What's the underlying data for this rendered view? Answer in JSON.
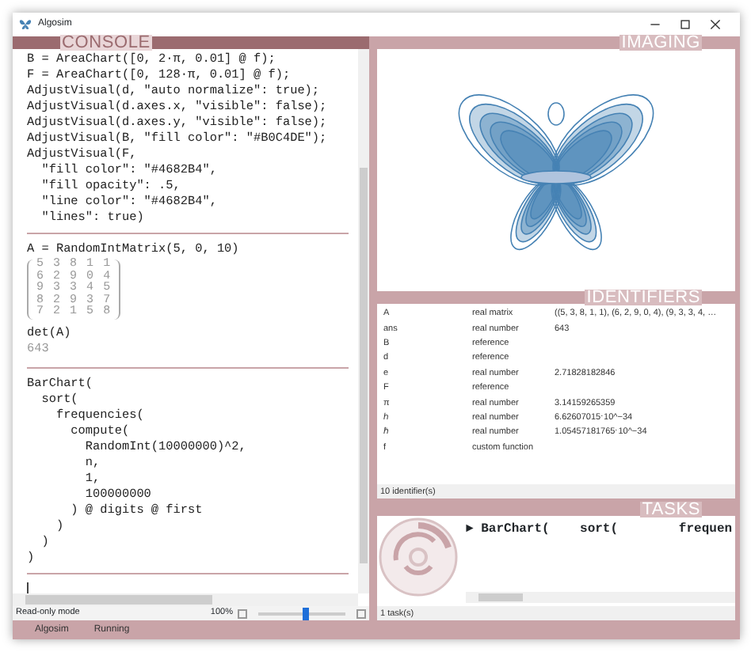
{
  "window": {
    "title": "Algosim"
  },
  "console": {
    "header": "CONSOLE",
    "blocks": [
      {
        "items": [
          {
            "input": [
              "B = AreaChart([0, 2·π, 0.01] @ f);",
              "F = AreaChart([0, 128·π, 0.01] @ f);",
              "AdjustVisual(d, \"auto normalize\": true);",
              "AdjustVisual(d.axes.x, \"visible\": false);",
              "AdjustVisual(d.axes.y, \"visible\": false);",
              "AdjustVisual(B, \"fill color\": \"#B0C4DE\");",
              "AdjustVisual(F,",
              "  \"fill color\": \"#4682B4\",",
              "  \"fill opacity\": .5,",
              "  \"line color\": \"#4682B4\",",
              "  \"lines\": true)"
            ]
          }
        ]
      },
      {
        "items": [
          {
            "input": [
              "A = RandomIntMatrix(5, 0, 10)"
            ],
            "output": {
              "kind": "matrix",
              "rows": [
                [
                  "5",
                  "3",
                  "8",
                  "1",
                  "1"
                ],
                [
                  "6",
                  "2",
                  "9",
                  "0",
                  "4"
                ],
                [
                  "9",
                  "3",
                  "3",
                  "4",
                  "5"
                ],
                [
                  "8",
                  "2",
                  "9",
                  "3",
                  "7"
                ],
                [
                  "7",
                  "2",
                  "1",
                  "5",
                  "8"
                ]
              ]
            }
          },
          {
            "input": [
              "det(A)"
            ],
            "output": {
              "kind": "text",
              "text": "643"
            }
          }
        ]
      },
      {
        "items": [
          {
            "input": [
              "BarChart(",
              "  sort(",
              "    frequencies(",
              "      compute(",
              "        RandomInt(10000000)^2,",
              "        n,",
              "        1,",
              "        100000000",
              "      ) @ digits @ first",
              "    )",
              "  )",
              ")"
            ]
          }
        ]
      }
    ],
    "status": "Read-only mode",
    "zoom": "100%",
    "zoom_slider": {
      "level": 0.55
    }
  },
  "imaging": {
    "header": "IMAGING"
  },
  "identifiers": {
    "header": "IDENTIFIERS",
    "rows": [
      {
        "name": "A",
        "type": "real matrix",
        "value": "((5, 3, 8, 1, 1), (6, 2, 9, 0, 4), (9, 3, 3, 4, …"
      },
      {
        "name": "ans",
        "type": "real number",
        "value": "643"
      },
      {
        "name": "B",
        "type": "reference"
      },
      {
        "name": "d",
        "type": "reference"
      },
      {
        "name": "e",
        "type": "real number",
        "value": "2.71828182846"
      },
      {
        "name": "F",
        "type": "reference"
      },
      {
        "name": "π",
        "type": "real number",
        "value": "3.14159265359"
      },
      {
        "name": "ℎ",
        "type": "real number",
        "value": "6.62607015⋅10^−34"
      },
      {
        "name": "ℏ",
        "type": "real number",
        "value": "1.05457181765⋅10^−34"
      },
      {
        "name": "f",
        "type": "custom function"
      }
    ],
    "count": "10 identifier(s)"
  },
  "tasks": {
    "header": "TASKS",
    "items": [
      {
        "marker": "►",
        "text": "BarChart(    sort(        frequen"
      }
    ],
    "count": "1 task(s)"
  },
  "bottom_bar": [
    "Algosim",
    "Running"
  ]
}
